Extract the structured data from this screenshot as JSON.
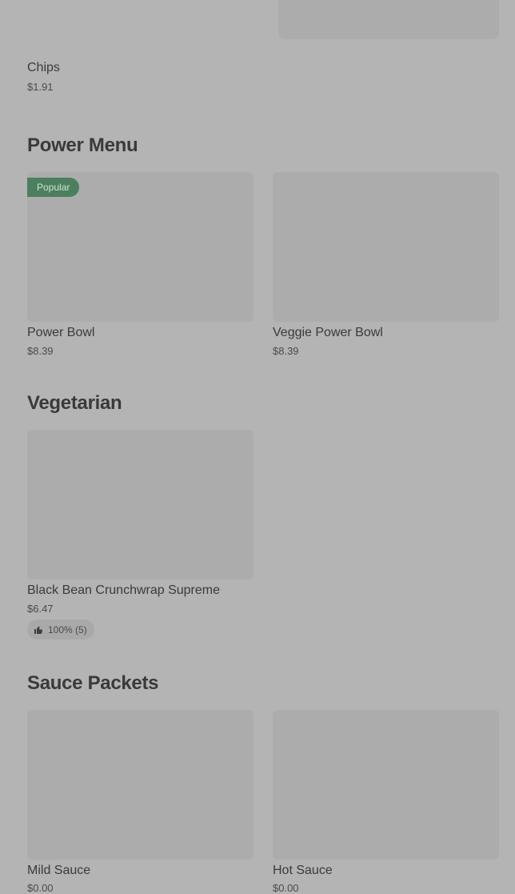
{
  "top_item": {
    "name": "Chips",
    "price": "$1.91"
  },
  "sections": [
    {
      "title": "Power Menu",
      "items": [
        {
          "name": "Power Bowl",
          "price": "$8.39",
          "badge": "Popular"
        },
        {
          "name": "Veggie Power Bowl",
          "price": "$8.39"
        }
      ]
    },
    {
      "title": "Vegetarian",
      "items": [
        {
          "name": "Black Bean Crunchwrap Supreme",
          "price": "$6.47",
          "rating": "100% (5)"
        }
      ]
    },
    {
      "title": "Sauce Packets",
      "items": [
        {
          "name": "Mild Sauce",
          "price": "$0.00"
        },
        {
          "name": "Hot Sauce",
          "price": "$0.00"
        }
      ]
    }
  ],
  "icons": {
    "rating": "thumbs-up-icon"
  },
  "colors": {
    "badge_bg": "#4b7f5d",
    "page_bg": "#b4b4b4"
  }
}
